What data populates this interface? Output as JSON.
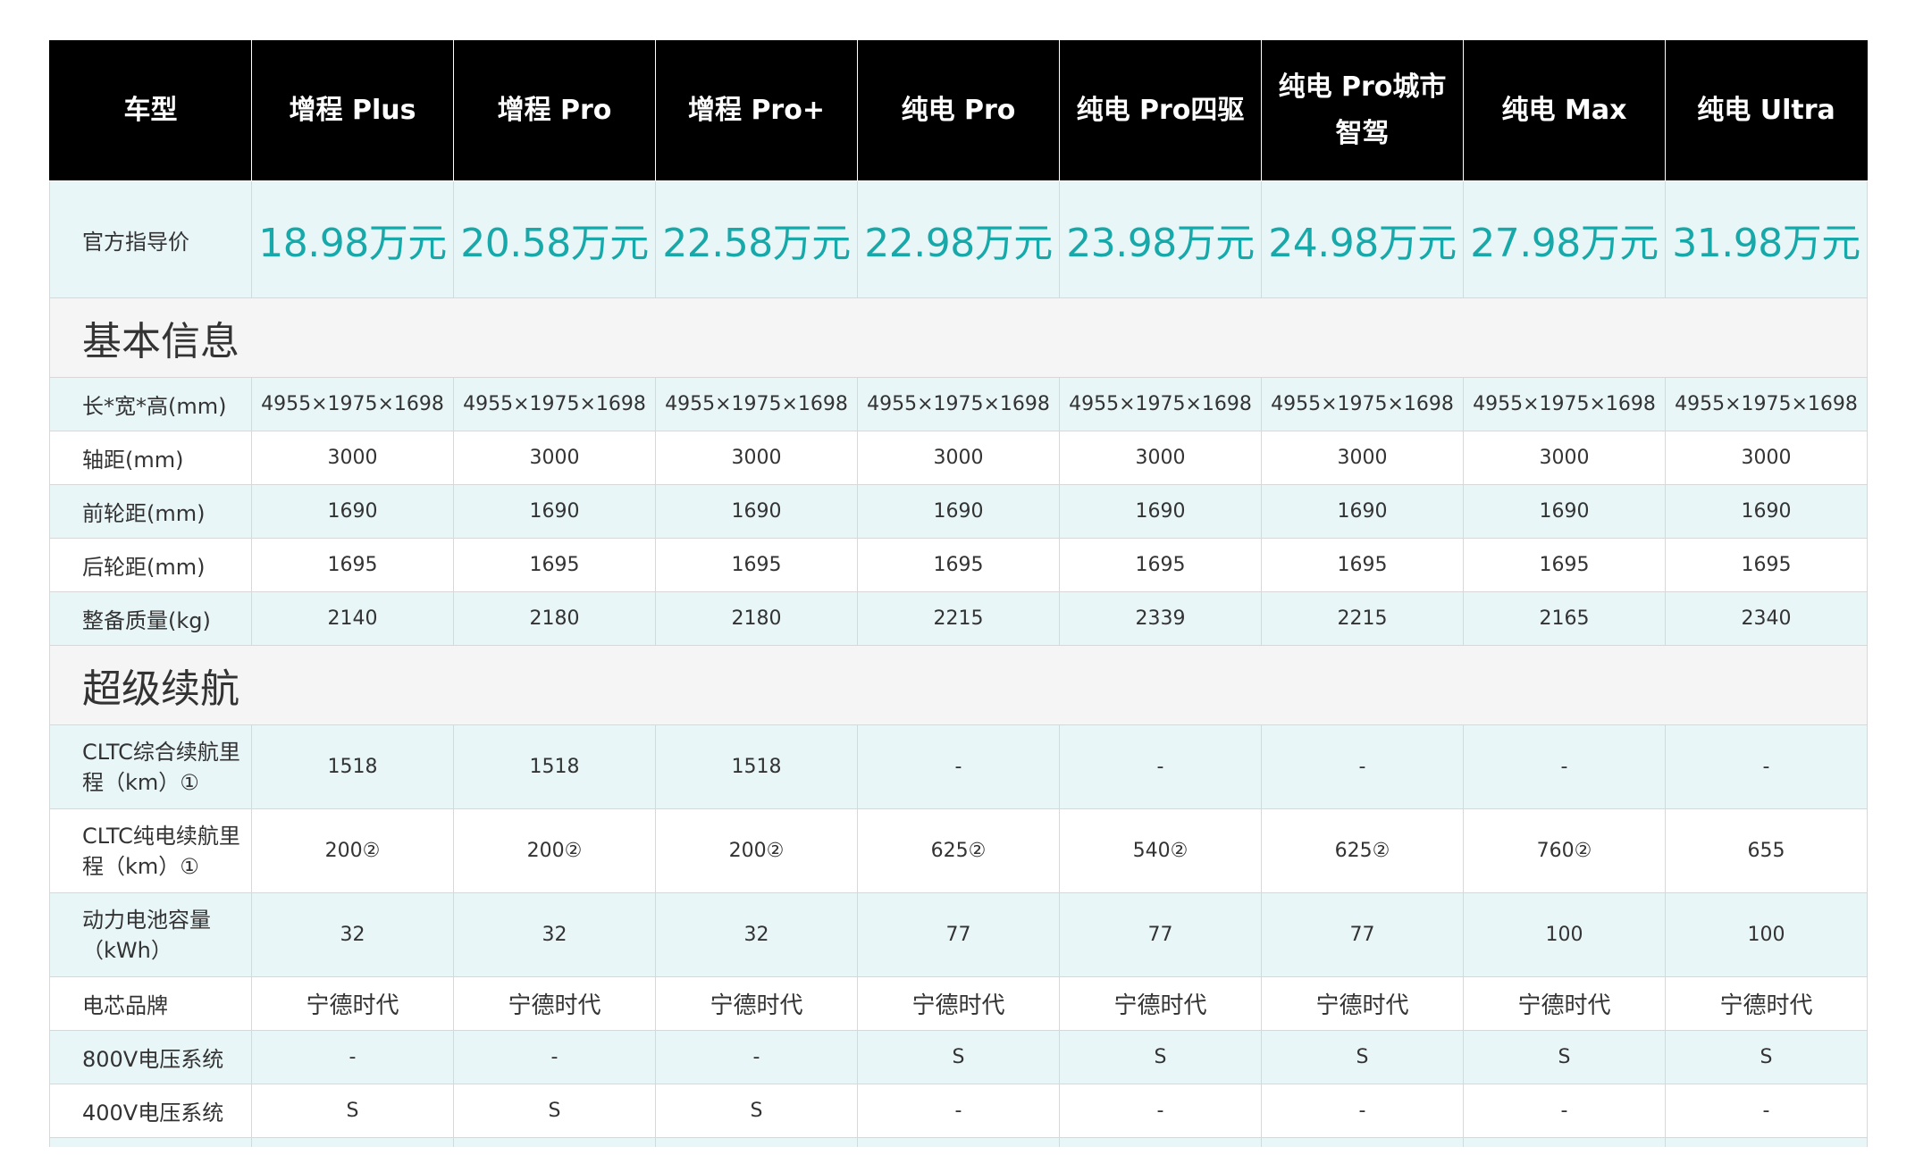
{
  "header": {
    "corner": "车型",
    "models": [
      "增程 Plus",
      "增程 Pro",
      "增程 Pro+",
      "纯电 Pro",
      "纯电 Pro四驱",
      "纯电 Pro城市智驾",
      "纯电 Max",
      "纯电 Ultra"
    ]
  },
  "price": {
    "label": "官方指导价",
    "values": [
      "18.98万元",
      "20.58万元",
      "22.58万元",
      "22.98万元",
      "23.98万元",
      "24.98万元",
      "27.98万元",
      "31.98万元"
    ]
  },
  "sections": [
    {
      "title": "基本信息",
      "rows": [
        {
          "label": "长*宽*高(mm)",
          "values": [
            "4955×1975×1698",
            "4955×1975×1698",
            "4955×1975×1698",
            "4955×1975×1698",
            "4955×1975×1698",
            "4955×1975×1698",
            "4955×1975×1698",
            "4955×1975×1698"
          ]
        },
        {
          "label": "轴距(mm)",
          "values": [
            "3000",
            "3000",
            "3000",
            "3000",
            "3000",
            "3000",
            "3000",
            "3000"
          ]
        },
        {
          "label": "前轮距(mm)",
          "values": [
            "1690",
            "1690",
            "1690",
            "1690",
            "1690",
            "1690",
            "1690",
            "1690"
          ]
        },
        {
          "label": "后轮距(mm)",
          "values": [
            "1695",
            "1695",
            "1695",
            "1695",
            "1695",
            "1695",
            "1695",
            "1695"
          ]
        },
        {
          "label": "整备质量(kg)",
          "values": [
            "2140",
            "2180",
            "2180",
            "2215",
            "2339",
            "2215",
            "2165",
            "2340"
          ]
        }
      ]
    },
    {
      "title": "超级续航",
      "rows": [
        {
          "label": "CLTC综合续航里程（km）①",
          "tall": true,
          "values": [
            "1518",
            "1518",
            "1518",
            "-",
            "-",
            "-",
            "-",
            "-"
          ]
        },
        {
          "label": "CLTC纯电续航里程（km）①",
          "tall": true,
          "values": [
            "200②",
            "200②",
            "200②",
            "625②",
            "540②",
            "625②",
            "760②",
            "655"
          ]
        },
        {
          "label": "动力电池容量（kWh）",
          "tall": true,
          "values": [
            "32",
            "32",
            "32",
            "77",
            "77",
            "77",
            "100",
            "100"
          ]
        },
        {
          "label": "电芯品牌",
          "big": true,
          "values": [
            "宁德时代",
            "宁德时代",
            "宁德时代",
            "宁德时代",
            "宁德时代",
            "宁德时代",
            "宁德时代",
            "宁德时代"
          ]
        },
        {
          "label": "800V电压系统",
          "values": [
            "-",
            "-",
            "-",
            "S",
            "S",
            "S",
            "S",
            "S"
          ]
        },
        {
          "label": "400V电压系统",
          "values": [
            "S",
            "S",
            "S",
            "-",
            "-",
            "-",
            "-",
            "-"
          ]
        }
      ]
    }
  ]
}
